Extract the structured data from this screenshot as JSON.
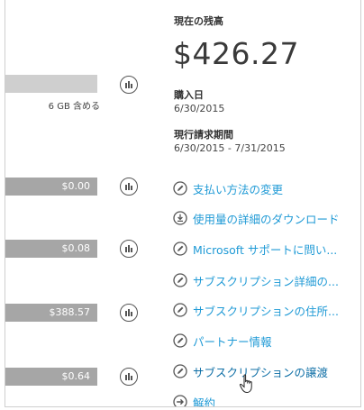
{
  "balance": {
    "label": "現在の残高",
    "amount": "$426.27"
  },
  "purchase": {
    "label": "購入日",
    "date": "6/30/2015"
  },
  "billing": {
    "label": "現行請求期間",
    "period": "6/30/2015 - 7/31/2015"
  },
  "usage_rows": [
    {
      "value": "",
      "sublabel": "6 GB 含める"
    },
    {
      "value": "$0.00",
      "sublabel": ""
    },
    {
      "value": "$0.08",
      "sublabel": ""
    },
    {
      "value": "$388.57",
      "sublabel": ""
    },
    {
      "value": "$0.64",
      "sublabel": ""
    }
  ],
  "actions": [
    {
      "label": "支払い方法の変更",
      "icon": "pencil-icon"
    },
    {
      "label": "使用量の詳細のダウンロード",
      "icon": "download-icon"
    },
    {
      "label": "Microsoft サポートに問い...",
      "icon": "pencil-icon"
    },
    {
      "label": "サブスクリプション詳細の...",
      "icon": "pencil-icon"
    },
    {
      "label": "サブスクリプションの住所...",
      "icon": "pencil-icon"
    },
    {
      "label": "パートナー情報",
      "icon": "pencil-icon"
    },
    {
      "label": "サブスクリプションの譲渡",
      "icon": "pencil-icon"
    },
    {
      "label": "解約",
      "icon": "arrow-right-icon"
    }
  ],
  "colors": {
    "link": "#1f9ad6",
    "bar": "#a6a6a6",
    "bar_light": "#cfcfcf"
  }
}
